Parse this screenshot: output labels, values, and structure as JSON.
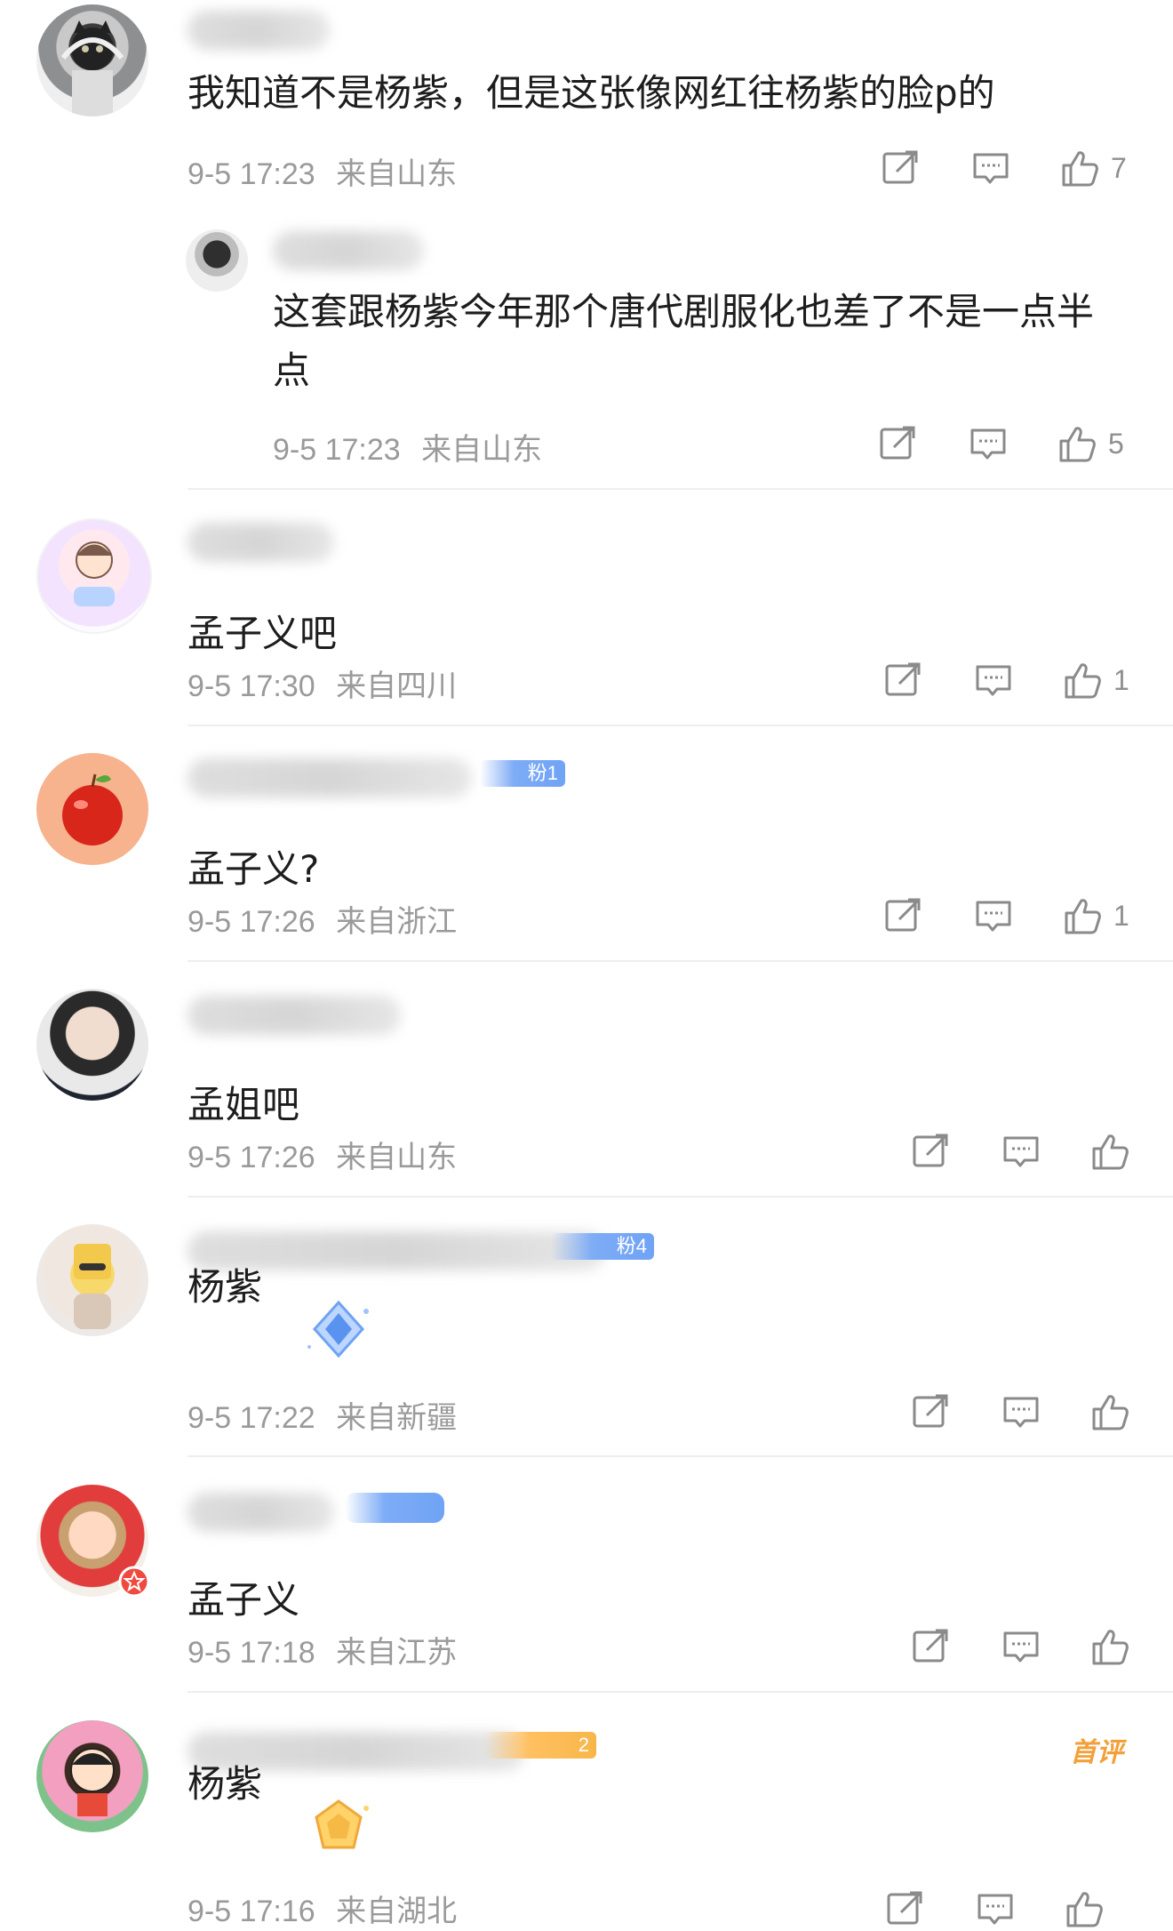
{
  "icons": {
    "forward": "share-edit-icon",
    "reply": "comment-bubble-icon",
    "like": "thumbs-up-icon"
  },
  "colors": {
    "meta": "#9a9a9a",
    "fan_badge_blue": "#7eacf6",
    "fan_badge_orange": "#f8b64a",
    "first_comment": "#f3a03a"
  },
  "comments": [
    {
      "text": "我知道不是杨紫，但是这张像网红往杨紫的脸p的",
      "time": "9-5 17:23",
      "location": "来自山东",
      "likes": "7"
    },
    {
      "text": "这套跟杨紫今年那个唐代剧服化也差了不是一点半点",
      "time": "9-5 17:23",
      "location": "来自山东",
      "likes": "5"
    },
    {
      "text": "孟子义吧",
      "time": "9-5 17:30",
      "location": "来自四川",
      "likes": "1"
    },
    {
      "text": "孟子义?",
      "time": "9-5 17:26",
      "location": "来自浙江",
      "likes": "1",
      "fan_badge": "粉1"
    },
    {
      "text": "孟姐吧",
      "time": "9-5 17:26",
      "location": "来自山东",
      "likes": ""
    },
    {
      "text": "杨紫",
      "time": "9-5 17:22",
      "location": "来自新疆",
      "likes": "",
      "fan_badge": "粉4"
    },
    {
      "text": "孟子义",
      "time": "9-5 17:18",
      "location": "来自江苏",
      "likes": ""
    },
    {
      "text": "杨紫",
      "time": "9-5 17:16",
      "location": "来自湖北",
      "likes": "",
      "fan_badge": "2",
      "tag": "首评"
    }
  ]
}
